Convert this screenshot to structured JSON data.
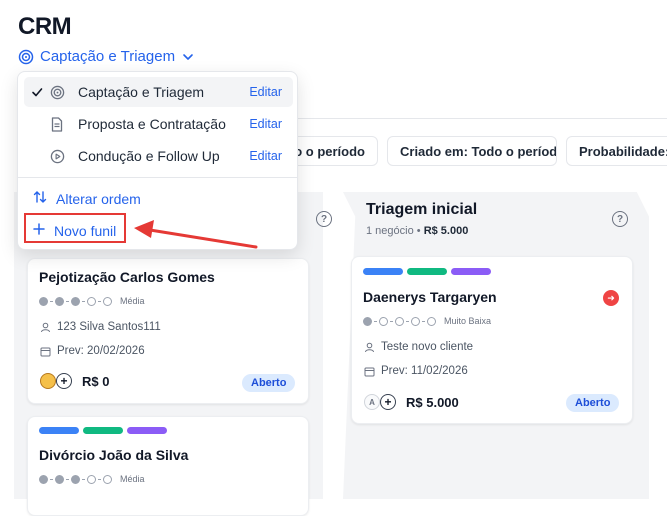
{
  "app": {
    "title": "CRM"
  },
  "funnel_selector": {
    "current": "Captação e Triagem",
    "icon": "target-icon"
  },
  "dropdown": {
    "items": [
      {
        "label": "Captação e Triagem",
        "edit": "Editar",
        "selected": true,
        "icon": "target-icon"
      },
      {
        "label": "Proposta e Contratação",
        "edit": "Editar",
        "selected": false,
        "icon": "document-icon"
      },
      {
        "label": "Condução e Follow Up",
        "edit": "Editar",
        "selected": false,
        "icon": "play-circle-icon"
      }
    ],
    "reorder_label": "Alterar ordem",
    "new_funnel_label": "Novo funil"
  },
  "filters": [
    {
      "label": "do o período"
    },
    {
      "label": "Criado em: Todo o período"
    },
    {
      "label": "Probabilidade: T"
    }
  ],
  "columns": [
    {
      "title": "Triagem inicial",
      "count": "1 negócio",
      "total": "R$ 5.000",
      "cards": [
        {
          "name": "Daenerys Targaryen",
          "probability": "Muito Baixa",
          "contact": "Teste novo cliente",
          "due": "Prev: 11/02/2026",
          "avatar": "A",
          "value": "R$ 5.000",
          "status": "Aberto",
          "tags": [
            "#3b82f6",
            "#10b981",
            "#8b5cf6"
          ]
        }
      ]
    }
  ],
  "left_cards": [
    {
      "name": "Pejotização Carlos Gomes",
      "probability": "Média",
      "contact": "123 Silva Santos111",
      "due": "Prev: 20/02/2026",
      "value": "R$ 0",
      "status": "Aberto"
    },
    {
      "name": "Divórcio João da Silva",
      "probability": "Média",
      "tags": [
        "#3b82f6",
        "#10b981",
        "#8b5cf6"
      ]
    }
  ],
  "colors": {
    "accent": "#2563eb",
    "highlight": "#e53935",
    "badge_bg": "#dbeafe",
    "badge_text": "#1d4ed8"
  }
}
